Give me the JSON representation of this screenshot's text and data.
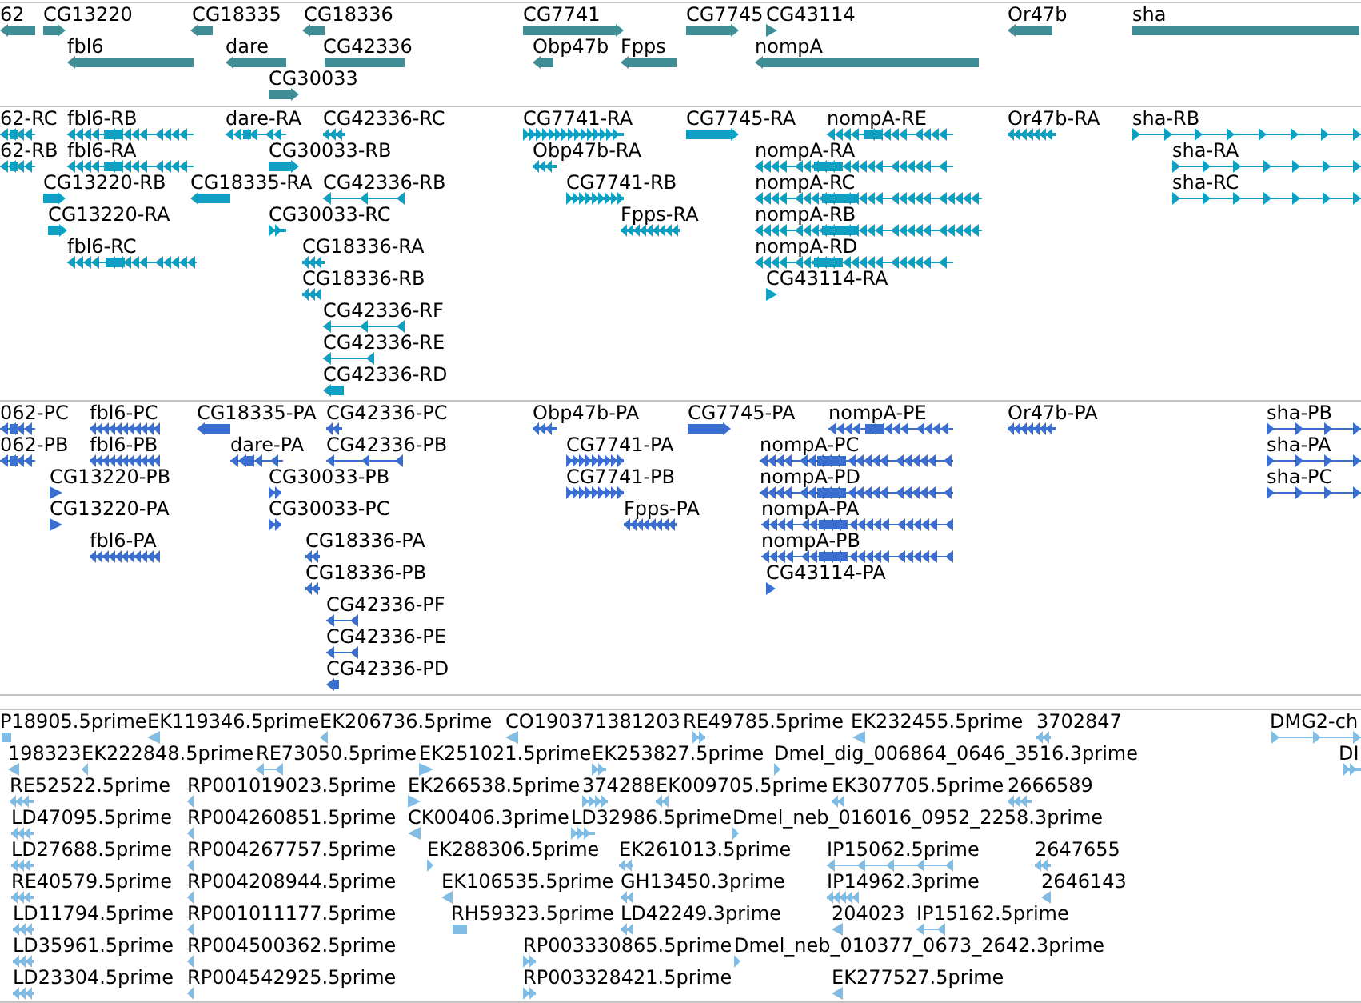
{
  "tracks": [
    {
      "color": "#3f8e96",
      "features": [
        {
          "label": "62",
          "reverse": true
        },
        {
          "label": "CG13220",
          "reverse": false
        },
        {
          "label": "CG18335",
          "reverse": true
        },
        {
          "label": "CG18336",
          "reverse": true
        },
        {
          "label": "CG7741",
          "reverse": false
        },
        {
          "label": "CG7745",
          "reverse": false
        },
        {
          "label": "CG43114",
          "reverse": false
        },
        {
          "label": "Or47b",
          "reverse": true
        },
        {
          "label": "sha",
          "reverse": false
        },
        {
          "label": "fbl6",
          "reverse": true
        },
        {
          "label": "dare",
          "reverse": true
        },
        {
          "label": "CG42336",
          "reverse": true
        },
        {
          "label": "Obp47b",
          "reverse": true
        },
        {
          "label": "Fpps",
          "reverse": true
        },
        {
          "label": "nompA",
          "reverse": true
        },
        {
          "label": "CG30033",
          "reverse": false
        }
      ]
    },
    {
      "color": "#0ea0c2",
      "features": [
        {
          "label": "62-RC",
          "reverse": true
        },
        {
          "label": "fbl6-RB",
          "reverse": true
        },
        {
          "label": "dare-RA",
          "reverse": true
        },
        {
          "label": "CG42336-RC",
          "reverse": true
        },
        {
          "label": "CG7741-RA",
          "reverse": false
        },
        {
          "label": "CG7745-RA",
          "reverse": false
        },
        {
          "label": "nompA-RE",
          "reverse": true
        },
        {
          "label": "Or47b-RA",
          "reverse": true
        },
        {
          "label": "sha-RB",
          "reverse": false
        },
        {
          "label": "62-RB",
          "reverse": true
        },
        {
          "label": "fbl6-RA",
          "reverse": true
        },
        {
          "label": "CG30033-RB",
          "reverse": false
        },
        {
          "label": "Obp47b-RA",
          "reverse": true
        },
        {
          "label": "nompA-RA",
          "reverse": true
        },
        {
          "label": "sha-RA",
          "reverse": false
        },
        {
          "label": "CG13220-RB",
          "reverse": false
        },
        {
          "label": "CG18335-RA",
          "reverse": true
        },
        {
          "label": "CG42336-RB",
          "reverse": true
        },
        {
          "label": "CG7741-RB",
          "reverse": false
        },
        {
          "label": "nompA-RC",
          "reverse": true
        },
        {
          "label": "sha-RC",
          "reverse": false
        },
        {
          "label": "CG13220-RA",
          "reverse": false
        },
        {
          "label": "CG30033-RC",
          "reverse": false
        },
        {
          "label": "Fpps-RA",
          "reverse": true
        },
        {
          "label": "nompA-RB",
          "reverse": true
        },
        {
          "label": "fbl6-RC",
          "reverse": true
        },
        {
          "label": "CG18336-RA",
          "reverse": true
        },
        {
          "label": "nompA-RD",
          "reverse": true
        },
        {
          "label": "CG18336-RB",
          "reverse": true
        },
        {
          "label": "CG43114-RA",
          "reverse": false
        },
        {
          "label": "CG42336-RF",
          "reverse": true
        },
        {
          "label": "CG42336-RE",
          "reverse": true
        },
        {
          "label": "CG42336-RD",
          "reverse": true
        }
      ]
    },
    {
      "color": "#3a6fd0",
      "features": [
        {
          "label": "062-PC",
          "reverse": true
        },
        {
          "label": "fbl6-PC",
          "reverse": true
        },
        {
          "label": "CG18335-PA",
          "reverse": true
        },
        {
          "label": "CG42336-PC",
          "reverse": true
        },
        {
          "label": "Obp47b-PA",
          "reverse": true
        },
        {
          "label": "CG7745-PA",
          "reverse": false
        },
        {
          "label": "nompA-PE",
          "reverse": true
        },
        {
          "label": "Or47b-PA",
          "reverse": true
        },
        {
          "label": "sha-PB",
          "reverse": false
        },
        {
          "label": "062-PB",
          "reverse": true
        },
        {
          "label": "fbl6-PB",
          "reverse": true
        },
        {
          "label": "dare-PA",
          "reverse": true
        },
        {
          "label": "CG42336-PB",
          "reverse": true
        },
        {
          "label": "CG7741-PA",
          "reverse": false
        },
        {
          "label": "nompA-PC",
          "reverse": true
        },
        {
          "label": "sha-PA",
          "reverse": false
        },
        {
          "label": "CG13220-PB",
          "reverse": false
        },
        {
          "label": "CG30033-PB",
          "reverse": false
        },
        {
          "label": "CG7741-PB",
          "reverse": false
        },
        {
          "label": "nompA-PD",
          "reverse": true
        },
        {
          "label": "sha-PC",
          "reverse": false
        },
        {
          "label": "CG13220-PA",
          "reverse": false
        },
        {
          "label": "CG30033-PC",
          "reverse": false
        },
        {
          "label": "Fpps-PA",
          "reverse": true
        },
        {
          "label": "nompA-PA",
          "reverse": true
        },
        {
          "label": "fbl6-PA",
          "reverse": true
        },
        {
          "label": "CG18336-PA",
          "reverse": true
        },
        {
          "label": "nompA-PB",
          "reverse": true
        },
        {
          "label": "CG18336-PB",
          "reverse": true
        },
        {
          "label": "CG43114-PA",
          "reverse": false
        },
        {
          "label": "CG42336-PF",
          "reverse": true
        },
        {
          "label": "CG42336-PE",
          "reverse": true
        },
        {
          "label": "CG42336-PD",
          "reverse": true
        }
      ]
    },
    {
      "color": "#80bce4",
      "features": [
        {
          "label": "P18905.5prime",
          "reverse": true
        },
        {
          "label": "EK119346.5prime",
          "reverse": true
        },
        {
          "label": "EK206736.5prime",
          "reverse": true
        },
        {
          "label": "CO190371381203",
          "reverse": true
        },
        {
          "label": "RE49785.5prime",
          "reverse": false
        },
        {
          "label": "EK232455.5prime",
          "reverse": true
        },
        {
          "label": "3702847",
          "reverse": true
        },
        {
          "label": "DMG2-ch",
          "reverse": false
        },
        {
          "label": "198323",
          "reverse": true
        },
        {
          "label": "EK222848.5prime",
          "reverse": true
        },
        {
          "label": "RE73050.5prime",
          "reverse": true
        },
        {
          "label": "EK251021.5prime",
          "reverse": false
        },
        {
          "label": "EK253827.5prime",
          "reverse": false
        },
        {
          "label": "Dmel_dig_006864_0646_3516.3prime",
          "reverse": false
        },
        {
          "label": "DI",
          "reverse": false
        },
        {
          "label": "RE52522.5prime",
          "reverse": true
        },
        {
          "label": "RP001019023.5prime",
          "reverse": true
        },
        {
          "label": "EK266538.5prime",
          "reverse": false
        },
        {
          "label": "374288",
          "reverse": false
        },
        {
          "label": "EK009705.5prime",
          "reverse": true
        },
        {
          "label": "EK307705.5prime",
          "reverse": true
        },
        {
          "label": "2666589",
          "reverse": true
        },
        {
          "label": "LD47095.5prime",
          "reverse": true
        },
        {
          "label": "RP004260851.5prime",
          "reverse": true
        },
        {
          "label": "CK00406.3prime",
          "reverse": true
        },
        {
          "label": "LD32986.5prime",
          "reverse": false
        },
        {
          "label": "Dmel_neb_016016_0952_2258.3prime",
          "reverse": false
        },
        {
          "label": "LD27688.5prime",
          "reverse": true
        },
        {
          "label": "RP004267757.5prime",
          "reverse": true
        },
        {
          "label": "EK288306.5prime",
          "reverse": false
        },
        {
          "label": "EK261013.5prime",
          "reverse": true
        },
        {
          "label": "IP15062.5prime",
          "reverse": true
        },
        {
          "label": "2647655",
          "reverse": true
        },
        {
          "label": "RE40579.5prime",
          "reverse": true
        },
        {
          "label": "RP004208944.5prime",
          "reverse": true
        },
        {
          "label": "EK106535.5prime",
          "reverse": true
        },
        {
          "label": "GH13450.3prime",
          "reverse": true
        },
        {
          "label": "IP14962.3prime",
          "reverse": true
        },
        {
          "label": "2646143",
          "reverse": true
        },
        {
          "label": "LD11794.5prime",
          "reverse": true
        },
        {
          "label": "RP001011177.5prime",
          "reverse": true
        },
        {
          "label": "RH59323.5prime",
          "reverse": true
        },
        {
          "label": "LD42249.3prime",
          "reverse": true
        },
        {
          "label": "204023",
          "reverse": true
        },
        {
          "label": "IP15162.5prime",
          "reverse": true
        },
        {
          "label": "LD35961.5prime",
          "reverse": true
        },
        {
          "label": "RP004500362.5prime",
          "reverse": true
        },
        {
          "label": "RP003330865.5prime",
          "reverse": false
        },
        {
          "label": "Dmel_neb_010377_0673_2642.3prime",
          "reverse": false
        },
        {
          "label": "LD23304.5prime",
          "reverse": true
        },
        {
          "label": "RP004542925.5prime",
          "reverse": true
        },
        {
          "label": "RP003328421.5prime",
          "reverse": false
        },
        {
          "label": "EK277527.5prime",
          "reverse": true
        }
      ]
    }
  ]
}
